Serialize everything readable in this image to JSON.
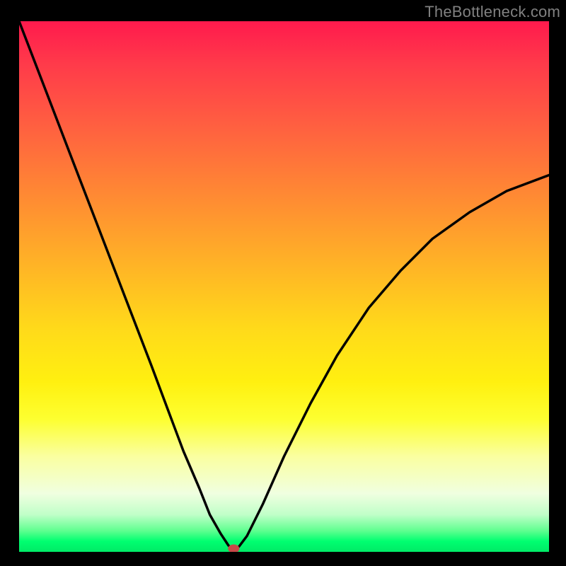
{
  "watermark": "TheBottleneck.com",
  "chart_data": {
    "type": "line",
    "title": "",
    "xlabel": "",
    "ylabel": "",
    "xlim": [
      0,
      100
    ],
    "ylim": [
      0,
      100
    ],
    "grid": false,
    "legend": false,
    "background": "rainbow-gradient-vertical",
    "series": [
      {
        "name": "bottleneck-curve",
        "x": [
          0,
          5,
          10,
          15,
          20,
          25,
          28,
          31,
          34,
          36,
          38,
          39.5,
          40.5,
          41.5,
          43,
          46,
          50,
          55,
          60,
          66,
          72,
          78,
          85,
          92,
          100
        ],
        "y": [
          100,
          87,
          74,
          61,
          48,
          35,
          27,
          19,
          12,
          7,
          3.5,
          1.2,
          0.3,
          1.0,
          3.0,
          9,
          18,
          28,
          37,
          46,
          53,
          59,
          64,
          68,
          71
        ]
      }
    ],
    "marker": {
      "x": 40.5,
      "y": 0.3,
      "color": "#c84848"
    }
  },
  "colors": {
    "frame": "#000000",
    "text": "#808080"
  }
}
